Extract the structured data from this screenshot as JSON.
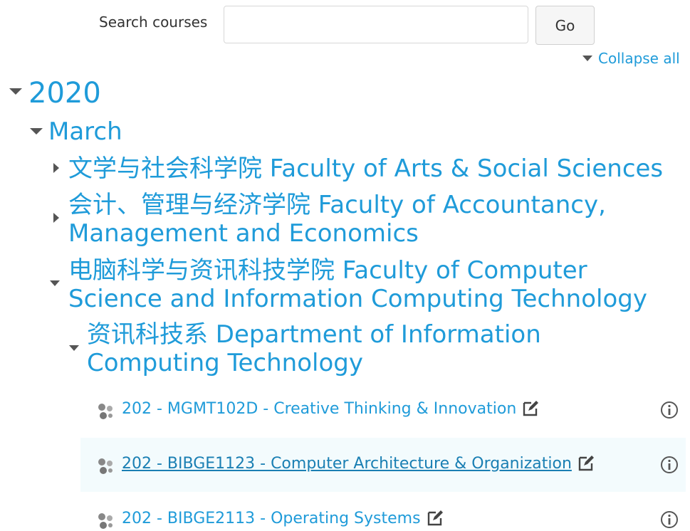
{
  "search": {
    "label": "Search courses",
    "value": "",
    "placeholder": "",
    "button_label": "Go"
  },
  "collapse_all": "Collapse all",
  "tree": {
    "year": "2020",
    "month": "March",
    "categories": [
      {
        "label": "文学与社会科学院 Faculty of Arts & Social Sciences",
        "expanded": false
      },
      {
        "label_line1": "会计、管理与经济学院 Faculty of Accountancy,",
        "label_line2": "Management and Economics",
        "expanded": false
      },
      {
        "label_line1": "电脑科学与资讯科技学院 Faculty of Computer",
        "label_line2": "Science and Information Computing Technology",
        "expanded": true
      }
    ],
    "department": {
      "label_line1": "资讯科技系 Department of Information",
      "label_line2": "Computing Technology",
      "expanded": true
    },
    "courses": [
      {
        "name": "202 - MGMT102D - Creative Thinking & Innovation"
      },
      {
        "name": "202 - BIBGE1123 - Computer Architecture & Organization",
        "hovered": true
      },
      {
        "name": "202 - BIBGE2113 - Operating Systems"
      }
    ]
  },
  "colors": {
    "link": "#1f9bd9",
    "link_hover": "#1a7fb3",
    "text": "#333333",
    "toggle": "#555555",
    "highlight_row": "#f3fbfd"
  },
  "icons": {
    "course": "course-icon",
    "edit": "edit-icon",
    "info": "info-icon",
    "expanded": "triangle-down-icon",
    "collapsed": "triangle-right-icon"
  }
}
